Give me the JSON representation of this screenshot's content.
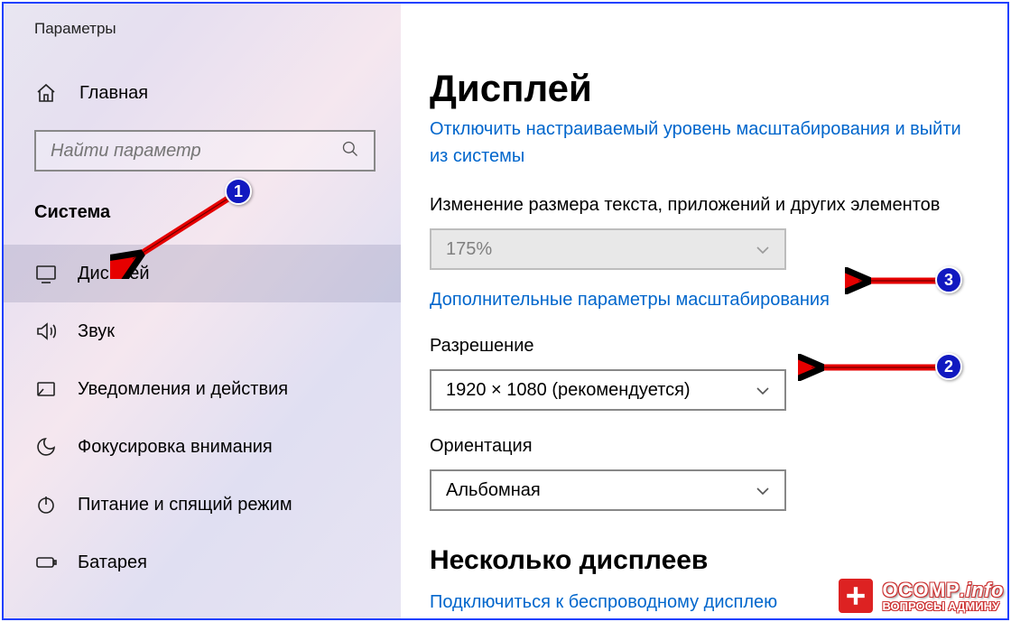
{
  "app_title": "Параметры",
  "home_label": "Главная",
  "search": {
    "placeholder": "Найти параметр"
  },
  "section_header": "Система",
  "nav": [
    {
      "key": "display",
      "label": "Дисплей",
      "active": true
    },
    {
      "key": "sound",
      "label": "Звук",
      "active": false
    },
    {
      "key": "notif",
      "label": "Уведомления и действия",
      "active": false
    },
    {
      "key": "focus",
      "label": "Фокусировка внимания",
      "active": false
    },
    {
      "key": "power",
      "label": "Питание и спящий режим",
      "active": false
    },
    {
      "key": "battery",
      "label": "Батарея",
      "active": false
    }
  ],
  "page": {
    "title": "Дисплей",
    "signout_link_truncated": "Отключить настраиваемый уровень масштабирования и выйти",
    "signout_link_line2": "из системы",
    "scale_label": "Изменение размера текста, приложений и других элементов",
    "scale_value": "175%",
    "advanced_scaling_link": "Дополнительные параметры масштабирования",
    "resolution_label": "Разрешение",
    "resolution_value": "1920 × 1080 (рекомендуется)",
    "orientation_label": "Ориентация",
    "orientation_value": "Альбомная",
    "multi_display_header": "Несколько дисплеев",
    "wireless_link": "Подключиться к беспроводному дисплею"
  },
  "annotations": {
    "badges": {
      "1": "1",
      "2": "2",
      "3": "3"
    }
  },
  "watermark": {
    "brand": "OCOMP",
    "suffix": ".info",
    "tagline": "ВОПРОСЫ АДМИНУ"
  }
}
